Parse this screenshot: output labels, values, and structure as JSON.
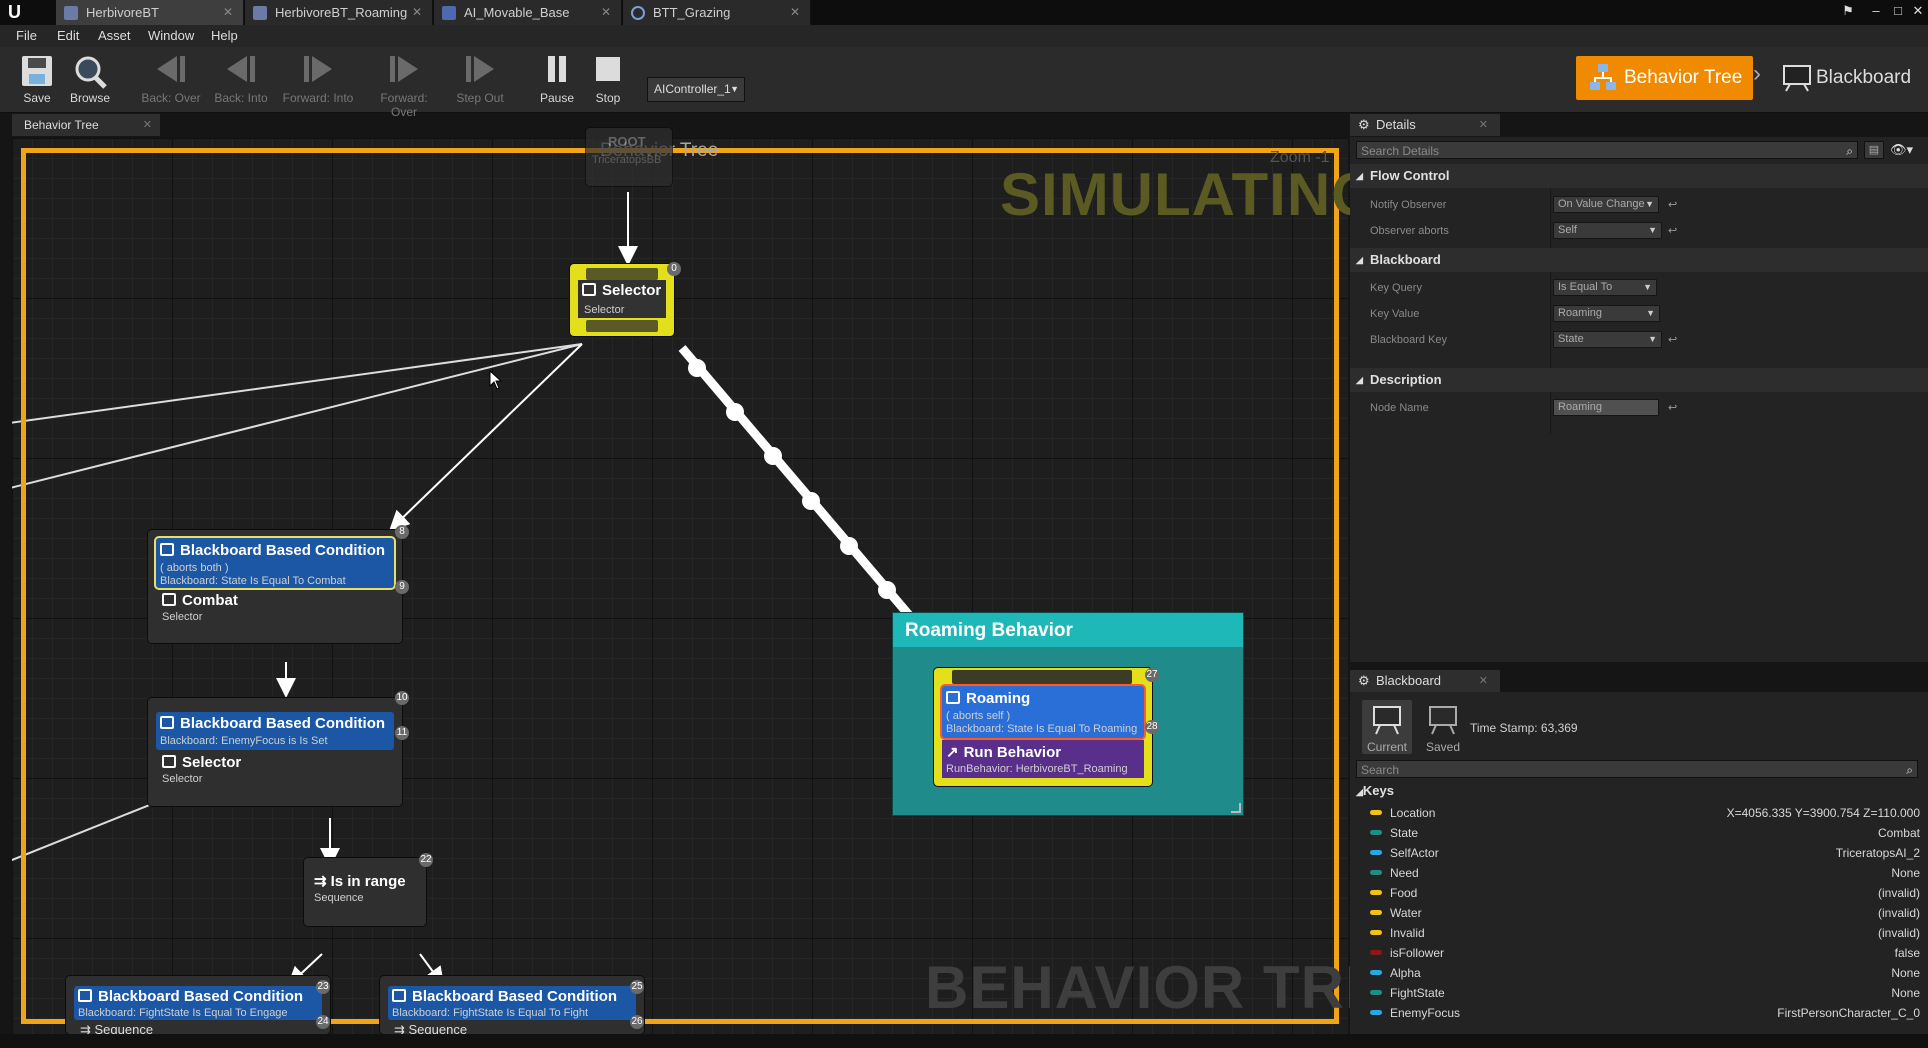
{
  "tabs": [
    {
      "label": "HerbivoreBT",
      "active": true
    },
    {
      "label": "HerbivoreBT_Roaming",
      "active": false
    },
    {
      "label": "AI_Movable_Base",
      "active": false
    },
    {
      "label": "BTT_Grazing",
      "active": false
    }
  ],
  "menu": [
    "File",
    "Edit",
    "Asset",
    "Window",
    "Help"
  ],
  "toolbar": {
    "save": "Save",
    "browse": "Browse",
    "back_over": "Back: Over",
    "back_into": "Back: Into",
    "forward_into": "Forward: Into",
    "forward_over": "Forward: Over",
    "step_out": "Step Out",
    "pause": "Pause",
    "stop": "Stop",
    "debug_object": "AIController_1",
    "mode_behavior_tree": "Behavior Tree",
    "mode_blackboard": "Blackboard"
  },
  "graph": {
    "tab": "Behavior Tree",
    "title": "Behavior Tree",
    "zoom": "Zoom -1",
    "simulating": "SIMULATING",
    "watermark": "BEHAVIOR TREE",
    "root": {
      "title": "ROOT",
      "subtitle": "TriceratopsBB"
    },
    "selector_main": {
      "title": "Selector",
      "subtitle": "Selector",
      "index": "0"
    },
    "combat": {
      "decorator_title": "Blackboard Based Condition",
      "decorator_line1": "( aborts both )",
      "decorator_line2": "Blackboard: State Is Equal To Combat",
      "title": "Combat",
      "subtitle": "Selector",
      "index": "8",
      "decorator_index": "9"
    },
    "enemy_selector": {
      "decorator_title": "Blackboard Based Condition",
      "decorator_line1": "Blackboard: EnemyFocus is Is Set",
      "title": "Selector",
      "subtitle": "Selector",
      "index": "10",
      "decorator_index": "11"
    },
    "in_range": {
      "title": "Is in range",
      "subtitle": "Sequence",
      "index": "22"
    },
    "engage": {
      "decorator_title": "Blackboard Based Condition",
      "decorator_line1": "Blackboard: FightState Is Equal To Engage",
      "subtitle": "Sequence",
      "index": "23",
      "decorator_index": "24"
    },
    "fight": {
      "decorator_title": "Blackboard Based Condition",
      "decorator_line1": "Blackboard: FightState Is Equal To Fight",
      "subtitle": "Sequence",
      "index": "25",
      "decorator_index": "26"
    },
    "roaming_comment": "Roaming Behavior",
    "roaming": {
      "decorator_title": "Roaming",
      "decorator_line1": "( aborts self )",
      "decorator_line2": "Blackboard: State Is Equal To Roaming",
      "task_title": "Run Behavior",
      "task_line": "RunBehavior: HerbivoreBT_Roaming",
      "index": "27",
      "decorator_index": "28"
    }
  },
  "details": {
    "tab": "Details",
    "search_placeholder": "Search Details",
    "categories": {
      "flow": "Flow Control",
      "blackboard": "Blackboard",
      "description": "Description"
    },
    "props": [
      {
        "label": "Notify Observer",
        "value": "On Value Change"
      },
      {
        "label": "Observer aborts",
        "value": "Self"
      },
      {
        "label": "Key Query",
        "value": "Is Equal To"
      },
      {
        "label": "Key Value",
        "value": "Roaming"
      },
      {
        "label": "Blackboard Key",
        "value": "State"
      },
      {
        "label": "Node Name",
        "value": "Roaming"
      }
    ]
  },
  "blackboard": {
    "tab": "Blackboard",
    "current": "Current",
    "saved": "Saved",
    "timestamp": "Time Stamp: 63,369",
    "search_placeholder": "Search",
    "keys_header": "Keys",
    "keys": [
      {
        "name": "Location",
        "value": "X=4056.335 Y=3900.754 Z=110.000",
        "color": "#f2c21b"
      },
      {
        "name": "State",
        "value": "Combat",
        "color": "#1f8f86"
      },
      {
        "name": "SelfActor",
        "value": "TriceratopsAI_2",
        "color": "#2aa6e0"
      },
      {
        "name": "Need",
        "value": "None",
        "color": "#1f8f86"
      },
      {
        "name": "Food",
        "value": "(invalid)",
        "color": "#f2c21b"
      },
      {
        "name": "Water",
        "value": "(invalid)",
        "color": "#f2c21b"
      },
      {
        "name": "Invalid",
        "value": "(invalid)",
        "color": "#f2c21b"
      },
      {
        "name": "isFollower",
        "value": "false",
        "color": "#8c1818"
      },
      {
        "name": "Alpha",
        "value": "None",
        "color": "#2aa6e0"
      },
      {
        "name": "FightState",
        "value": "None",
        "color": "#1f8f86"
      },
      {
        "name": "EnemyFocus",
        "value": "FirstPersonCharacter_C_0",
        "color": "#2aa6e0"
      }
    ]
  }
}
